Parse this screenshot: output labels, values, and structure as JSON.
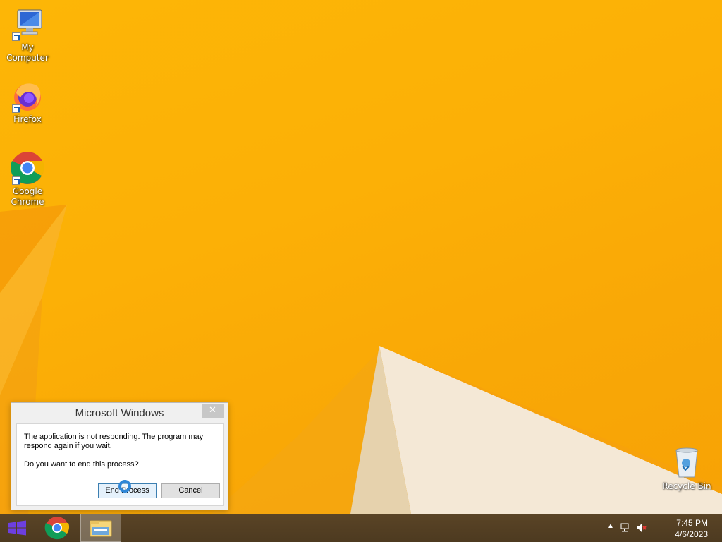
{
  "desktop_icons": {
    "my_computer": "My Computer",
    "firefox": "Firefox",
    "chrome": "Google Chrome",
    "recycle_bin": "Recycle Bin"
  },
  "dialog": {
    "title": "Microsoft Windows",
    "close_glyph": "✕",
    "message1": "The application is not responding. The program may respond again if you wait.",
    "message2": "Do you want to end this process?",
    "end_process_label": "End Process",
    "cancel_label": "Cancel"
  },
  "taskbar": {
    "pinned": [
      "start-button",
      "chrome",
      "file-explorer"
    ],
    "time": "7:45 PM",
    "date": "4/6/2023",
    "tray_icons": [
      "show-hidden-icons-icon",
      "network-icon",
      "volume-muted-icon"
    ]
  },
  "colors": {
    "wallpaper": "#fcb006",
    "taskbar": "#4d3a20",
    "start": "#5b2fd0",
    "accent_button": "#3c7fb1"
  }
}
